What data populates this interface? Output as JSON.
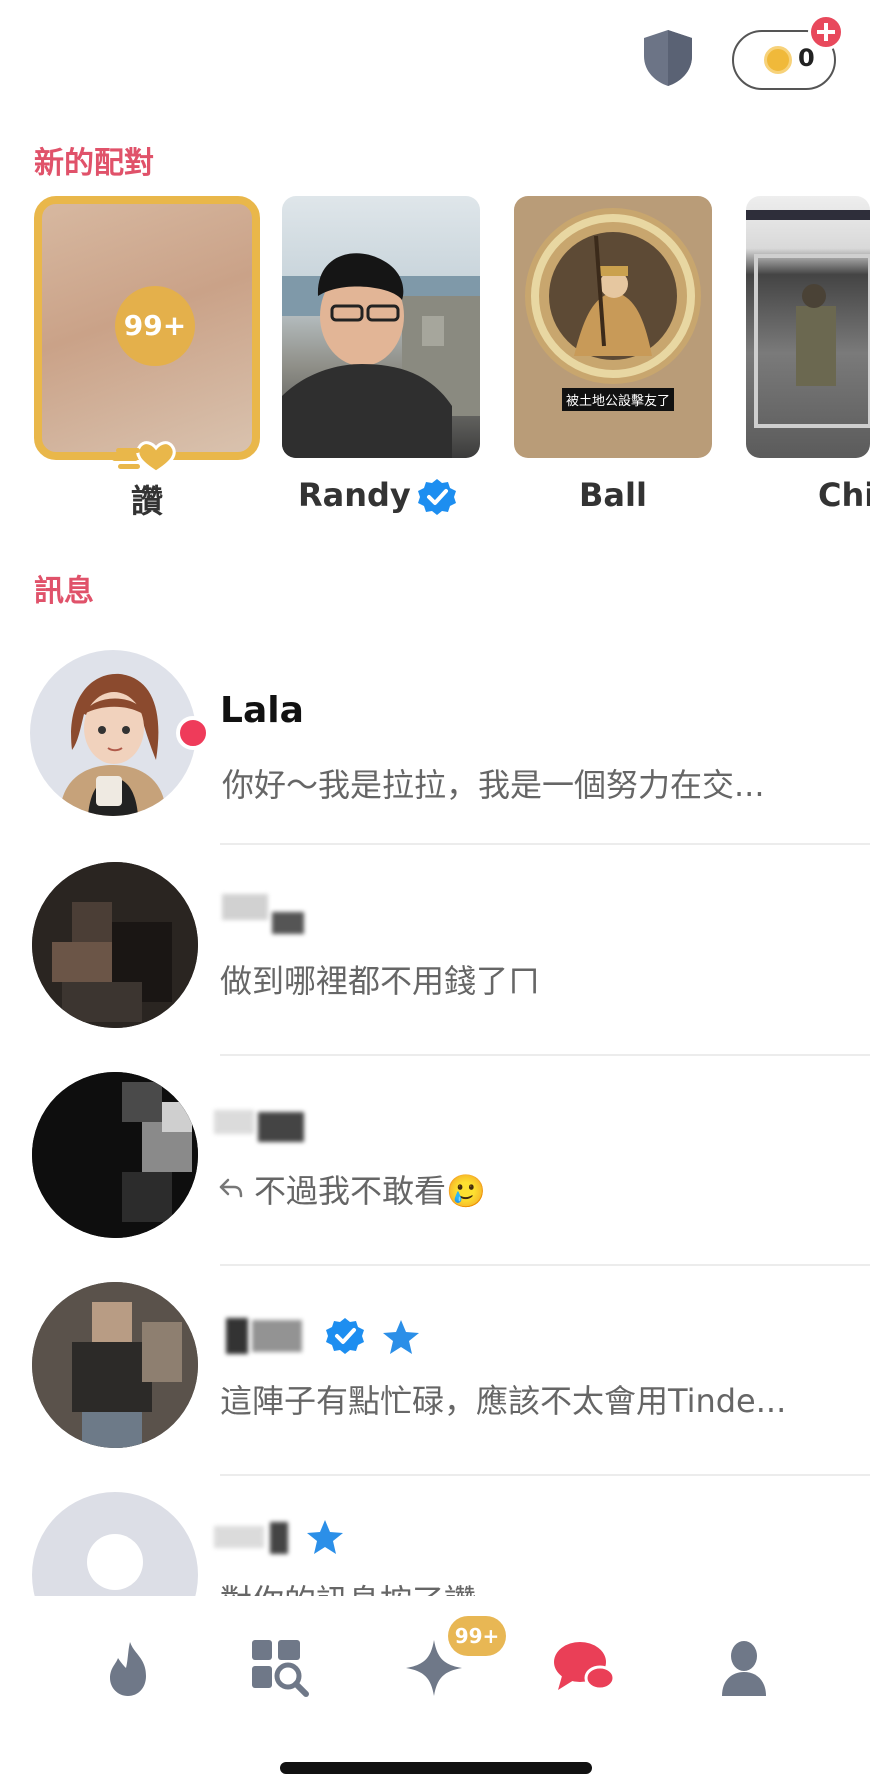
{
  "header": {
    "shield_icon": "shield-icon",
    "coins": {
      "icon": "coin-icon",
      "count": "0",
      "add_icon": "plus-icon"
    }
  },
  "matches": {
    "title": "新的配對",
    "likes": {
      "badge": "99+",
      "label": "讚",
      "icon": "heart-hand-icon",
      "accent": "#e9b74a"
    },
    "cards": [
      {
        "name": "Randy",
        "verified": true
      },
      {
        "name": "Ball",
        "caption": "被土地公設擊友了"
      },
      {
        "name": "Chi"
      }
    ]
  },
  "messages": {
    "title": "訊息",
    "items": [
      {
        "name": "Lala",
        "preview": "你好～我是拉拉，我是一個努力在交...",
        "unread": true
      },
      {
        "name": "",
        "preview": "做到哪裡都不用錢了ㄇ"
      },
      {
        "name": "",
        "preview": "不過我不敢看🥲",
        "replied": true
      },
      {
        "name": "",
        "preview": "這陣子有點忙碌，應該不太會用Tinde...",
        "verified": true,
        "star": true
      },
      {
        "name": "",
        "preview": "對你的訊息按了讚",
        "star": true
      }
    ]
  },
  "nav": {
    "items": [
      "flame-icon",
      "explore-icon",
      "sparkle-icon",
      "chat-icon",
      "profile-icon"
    ],
    "sparkle_badge": "99+",
    "active": "chat-icon"
  },
  "colors": {
    "brand": "#e0526a",
    "gold": "#e9b74a",
    "verified": "#1d8ef0",
    "inactive": "#6f7888"
  }
}
